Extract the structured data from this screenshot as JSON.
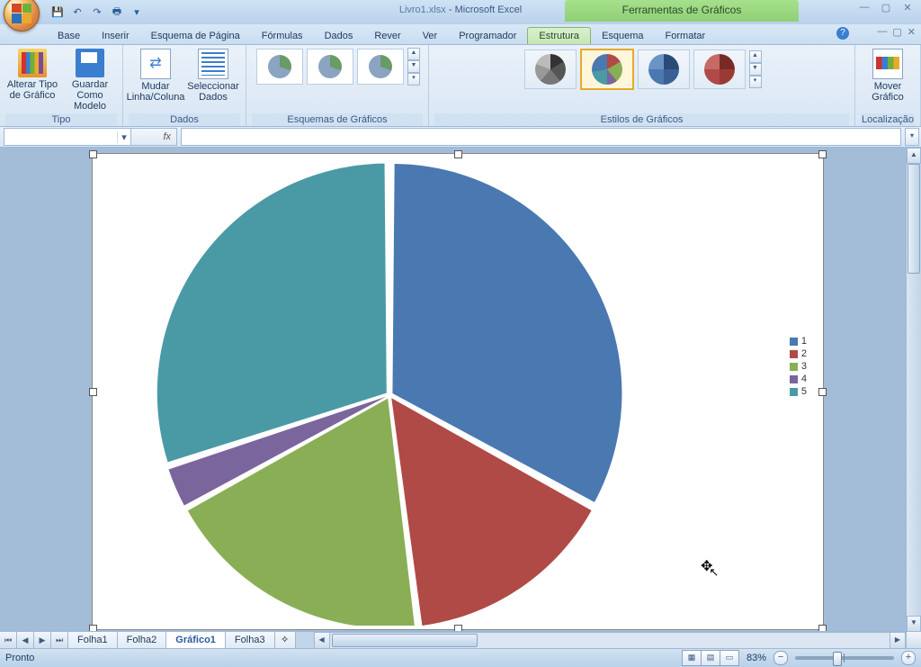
{
  "app": {
    "filename": "Livro1.xlsx",
    "appname": "Microsoft Excel",
    "tooltab_title": "Ferramentas de Gráficos"
  },
  "tabs": {
    "base": "Base",
    "inserir": "Inserir",
    "esquema_pagina": "Esquema de Página",
    "formulas": "Fórmulas",
    "dados": "Dados",
    "rever": "Rever",
    "ver": "Ver",
    "programador": "Programador",
    "estrutura": "Estrutura",
    "esquema": "Esquema",
    "formatar": "Formatar"
  },
  "ribbon": {
    "tipo": {
      "label": "Tipo",
      "alterar": "Alterar Tipo de Gráfico",
      "guardar": "Guardar Como Modelo"
    },
    "dados": {
      "label": "Dados",
      "mudar": "Mudar Linha/Coluna",
      "seleccionar": "Seleccionar Dados"
    },
    "esquemas": {
      "label": "Esquemas de Gráficos"
    },
    "estilos": {
      "label": "Estilos de Gráficos"
    },
    "local": {
      "label": "Localização",
      "mover": "Mover Gráfico"
    }
  },
  "formula_bar": {
    "name": "",
    "fx": "fx",
    "value": ""
  },
  "chart_data": {
    "type": "pie",
    "categories": [
      "1",
      "2",
      "3",
      "4",
      "5"
    ],
    "values": [
      33,
      15,
      19,
      3,
      30
    ],
    "colors": [
      "#4a78b0",
      "#b04a46",
      "#8aae55",
      "#7a659c",
      "#4a9aa6"
    ],
    "legend_position": "right"
  },
  "sheets": {
    "items": [
      "Folha1",
      "Folha2",
      "Gráfico1",
      "Folha3"
    ],
    "active": "Gráfico1"
  },
  "status": {
    "ready": "Pronto",
    "zoom": "83%"
  }
}
